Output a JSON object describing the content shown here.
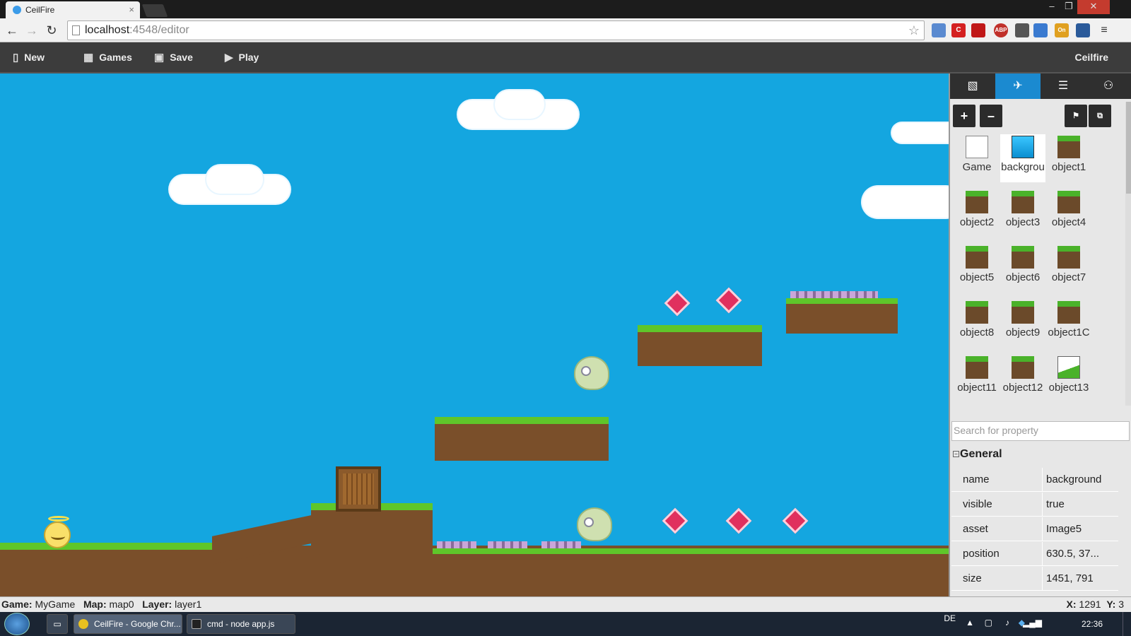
{
  "browser": {
    "tab_title": "CeilFire",
    "tab_close": "×",
    "url_host": "localhost",
    "url_rest": ":4548/editor",
    "window_controls": [
      "–",
      "❐",
      "✕"
    ],
    "extensions": [
      "C",
      "ABP",
      "On"
    ]
  },
  "toolbar": {
    "new_label": "New",
    "games_label": "Games",
    "save_label": "Save",
    "play_label": "Play",
    "brand": "Ceilfire"
  },
  "panel": {
    "tabs": [
      "image-icon",
      "plane-icon",
      "list-icon",
      "hierarchy-icon"
    ],
    "add_label": "+",
    "remove_label": "–",
    "objects": [
      {
        "label": "Game",
        "kind": "cards"
      },
      {
        "label": "backgrou",
        "kind": "blue",
        "selected": true
      },
      {
        "label": "object1",
        "kind": "grass"
      },
      {
        "label": "object2",
        "kind": "grass"
      },
      {
        "label": "object3",
        "kind": "grass"
      },
      {
        "label": "object4",
        "kind": "grass"
      },
      {
        "label": "object5",
        "kind": "grass"
      },
      {
        "label": "object6",
        "kind": "grass"
      },
      {
        "label": "object7",
        "kind": "grass"
      },
      {
        "label": "object8",
        "kind": "grass"
      },
      {
        "label": "object9",
        "kind": "grass"
      },
      {
        "label": "object1C",
        "kind": "grass"
      },
      {
        "label": "object11",
        "kind": "grass"
      },
      {
        "label": "object12",
        "kind": "grass"
      },
      {
        "label": "object13",
        "kind": "slope"
      }
    ],
    "search_placeholder": "Search for property",
    "group_title": "General",
    "group_toggle": "−",
    "properties": [
      {
        "key": "name",
        "value": "background"
      },
      {
        "key": "visible",
        "value": "true"
      },
      {
        "key": "asset",
        "value": "Image5"
      },
      {
        "key": "position",
        "value": "630.5, 37..."
      },
      {
        "key": "size",
        "value": "1451, 791"
      }
    ]
  },
  "status": {
    "game_label": "Game:",
    "game_value": "MyGame",
    "map_label": "Map:",
    "map_value": "map0",
    "layer_label": "Layer:",
    "layer_value": "layer1",
    "x_label": "X:",
    "x_value": "1291",
    "y_label": "Y:",
    "y_value": "3"
  },
  "taskbar": {
    "task1": "CeilFire - Google Chr...",
    "task2": "cmd - node  app.js",
    "lang": "DE",
    "time": "22:36"
  },
  "colors": {
    "sky": "#14a6e0",
    "accent_tab": "#1b8ad0",
    "toolbar": "#3c3c3c"
  }
}
